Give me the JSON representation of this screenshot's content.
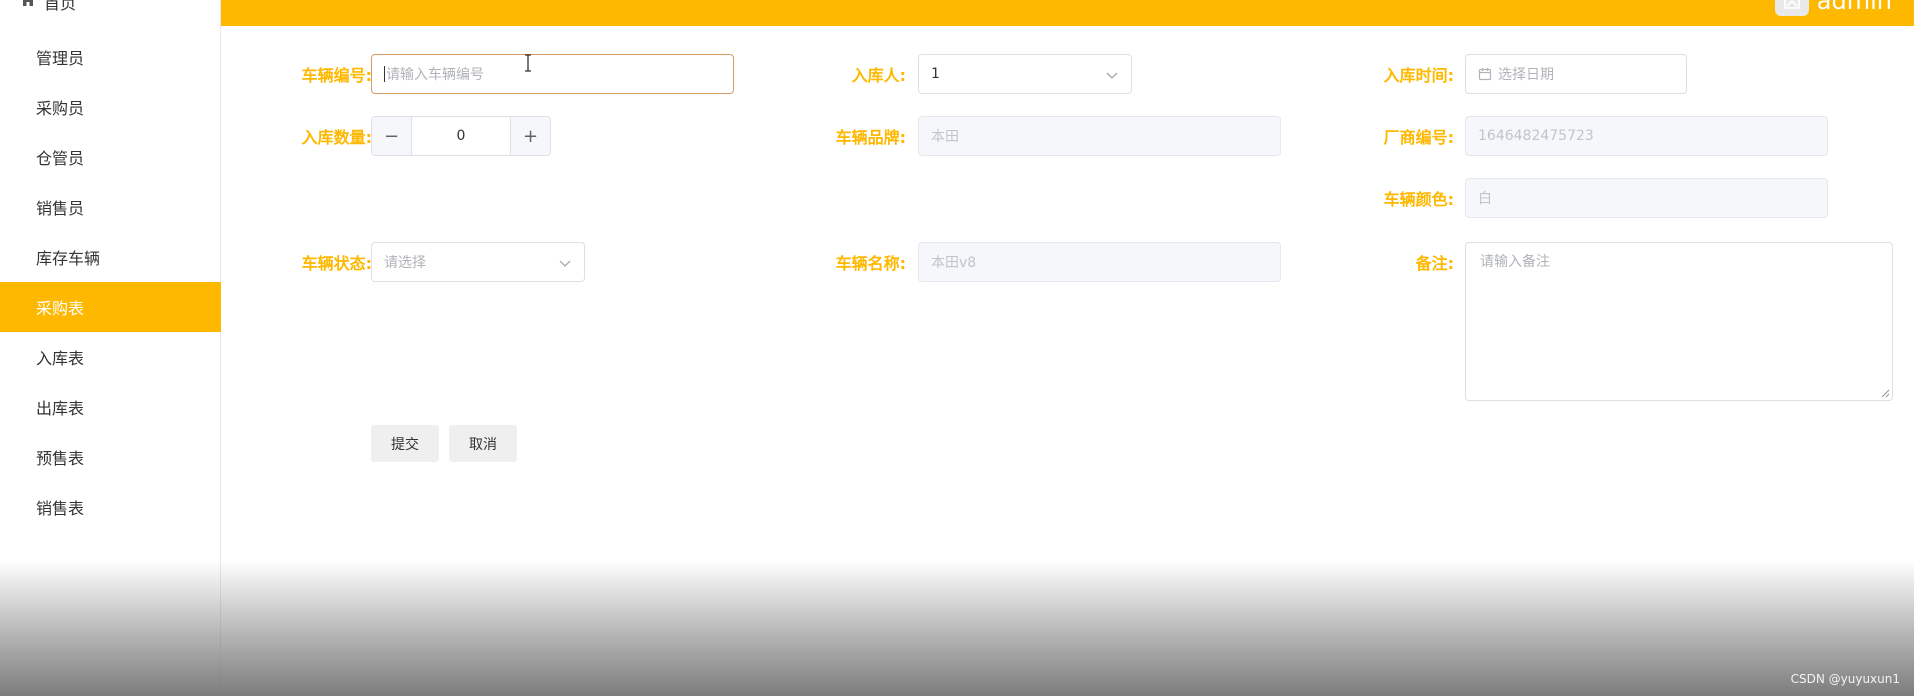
{
  "sidebar": {
    "home_label": "首页",
    "items": [
      {
        "label": "管理员"
      },
      {
        "label": "采购员"
      },
      {
        "label": "仓管员"
      },
      {
        "label": "销售员"
      },
      {
        "label": "库存车辆"
      },
      {
        "label": "采购表",
        "active": true
      },
      {
        "label": "入库表"
      },
      {
        "label": "出库表"
      },
      {
        "label": "预售表"
      },
      {
        "label": "销售表"
      }
    ]
  },
  "header": {
    "username": "admin",
    "accent_color": "#FFB800"
  },
  "form": {
    "vehicle_no": {
      "label": "车辆编号:",
      "placeholder": "请输入车辆编号"
    },
    "warehouse_person": {
      "label": "入库人:",
      "value": "1"
    },
    "warehouse_time": {
      "label": "入库时间:",
      "placeholder": "选择日期"
    },
    "quantity": {
      "label": "入库数量:",
      "value": "0",
      "minus": "−",
      "plus": "+"
    },
    "brand": {
      "label": "车辆品牌:",
      "value": "本田"
    },
    "manufacturer_no": {
      "label": "厂商编号:",
      "value": "1646482475723"
    },
    "color": {
      "label": "车辆颜色:",
      "value": "白"
    },
    "status": {
      "label": "车辆状态:",
      "placeholder": "请选择"
    },
    "vehicle_name": {
      "label": "车辆名称:",
      "value": "本田v8"
    },
    "remark": {
      "label": "备注:",
      "placeholder": "请输入备注"
    }
  },
  "actions": {
    "submit_label": "提交",
    "cancel_label": "取消"
  },
  "watermark": "CSDN @yuyuxun1"
}
